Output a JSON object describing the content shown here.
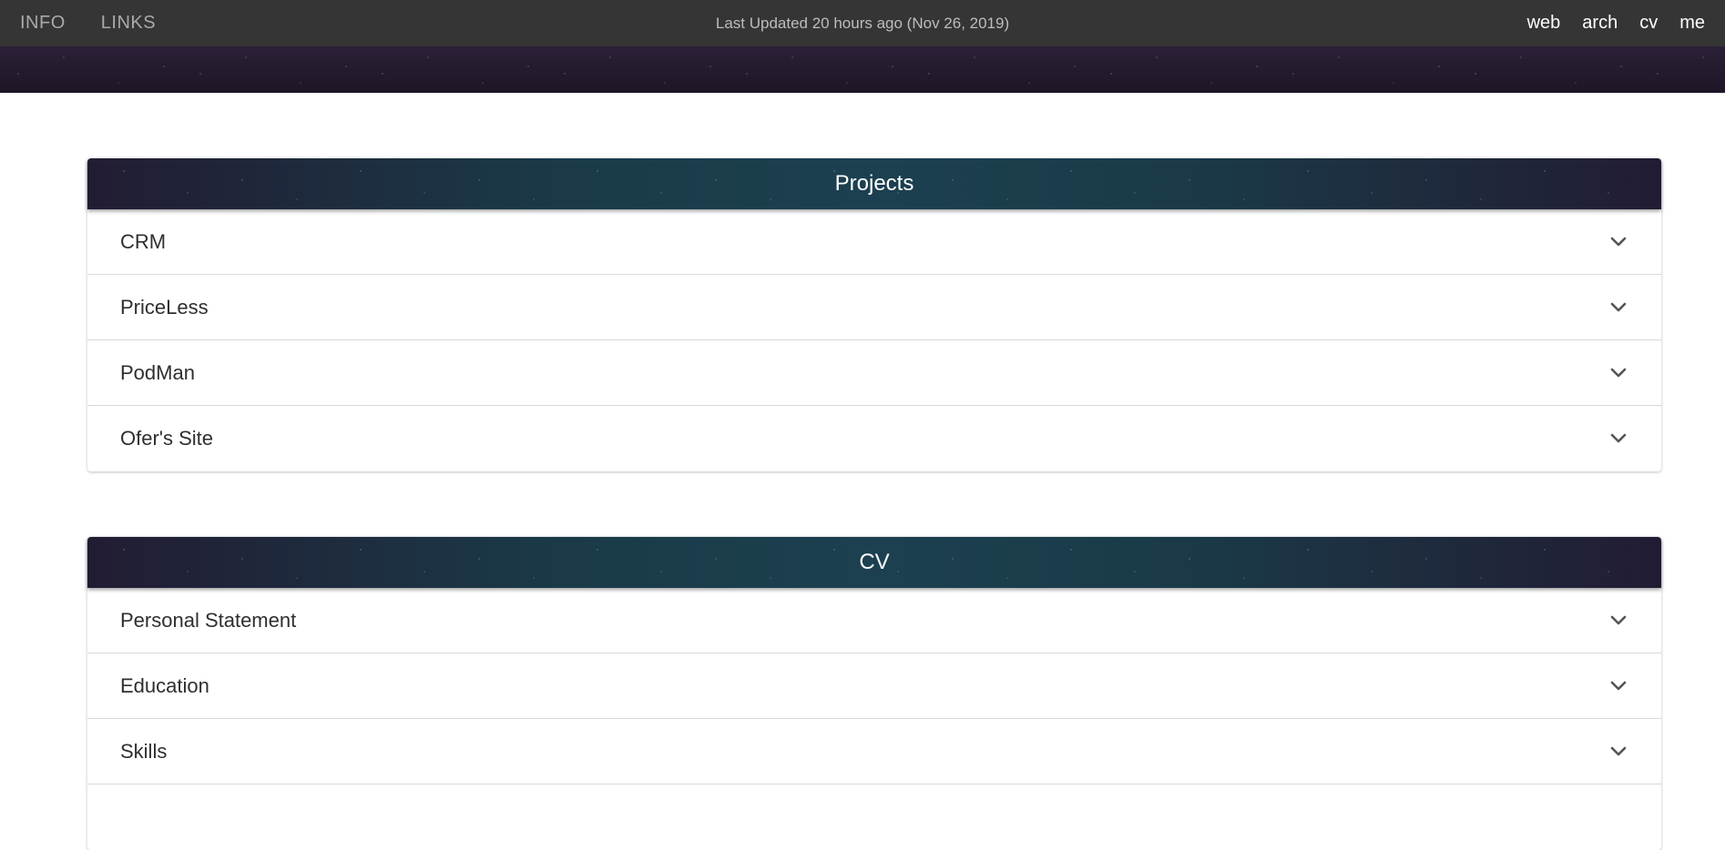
{
  "nav": {
    "left": [
      "INFO",
      "LINKS"
    ],
    "updated": "Last Updated 20 hours ago (Nov 26, 2019)",
    "right": [
      "web",
      "arch",
      "cv",
      "me"
    ]
  },
  "sections": {
    "projects": {
      "title": "Projects",
      "items": [
        "CRM",
        "PriceLess",
        "PodMan",
        "Ofer's Site"
      ]
    },
    "cv": {
      "title": "CV",
      "items": [
        "Personal Statement",
        "Education",
        "Skills",
        ""
      ]
    }
  },
  "icons": {
    "expand": "chevron-down-icon"
  },
  "colors": {
    "topbar": "#353535",
    "banner": "#241a2e",
    "header_teal": "#1c4050",
    "text": "#2f2f2f"
  }
}
